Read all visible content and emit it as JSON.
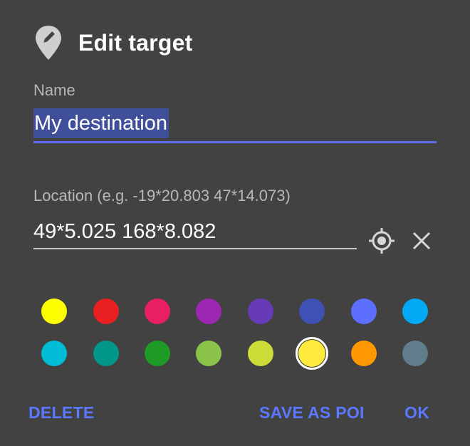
{
  "dialog": {
    "title": "Edit target",
    "title_icon": "map-pin-edit-icon"
  },
  "name_field": {
    "label": "Name",
    "value": "My destination",
    "selected": true
  },
  "location_field": {
    "label": "Location (e.g. -19*20.803 47*14.073)",
    "value": "49*5.025 168*8.082",
    "gps_icon": "gps-locate-icon",
    "clear_icon": "close-icon"
  },
  "colors": {
    "row1": [
      "#ffff00",
      "#e91f22",
      "#e91e63",
      "#9c27b0",
      "#673ab7",
      "#3f51b5",
      "#5c6fff",
      "#03a9f4"
    ],
    "row2": [
      "#00bcd4",
      "#009688",
      "#1f9a25",
      "#8bc34a",
      "#cddc39",
      "#ffeb3b",
      "#ff9800",
      "#607d8b"
    ],
    "selected_row": 2,
    "selected_index": 5
  },
  "actions": {
    "delete": "DELETE",
    "save_as_poi": "SAVE AS POI",
    "ok": "OK",
    "accent_color": "#5b78ff"
  }
}
